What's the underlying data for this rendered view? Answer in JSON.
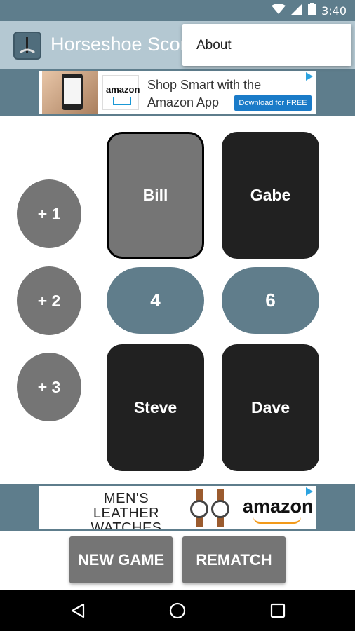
{
  "status_bar": {
    "time": "3:40",
    "icons": [
      "wifi-icon",
      "cell-signal-icon",
      "battery-icon"
    ]
  },
  "app_bar": {
    "title": "Horseshoe Score"
  },
  "overflow_menu": {
    "items": [
      {
        "label": "About"
      }
    ]
  },
  "ad_top": {
    "brand": "amazon",
    "headline": "Shop Smart with the Amazon App",
    "cta": "Download for FREE"
  },
  "ad_bottom": {
    "headline": "MEN'S LEATHER WATCHES",
    "brand": "amazon"
  },
  "increment_buttons": [
    {
      "label": "+ 1"
    },
    {
      "label": "+ 2"
    },
    {
      "label": "+ 3"
    }
  ],
  "teams": [
    {
      "score": "4",
      "players": [
        {
          "name": "Bill",
          "selected": true
        },
        {
          "name": "Steve",
          "selected": false
        }
      ]
    },
    {
      "score": "6",
      "players": [
        {
          "name": "Gabe",
          "selected": false
        },
        {
          "name": "Dave",
          "selected": false
        }
      ]
    }
  ],
  "actions": {
    "new_game": "NEW GAME",
    "rematch": "REMATCH"
  },
  "nav_bar": {
    "icons": [
      "back-icon",
      "home-icon",
      "recents-icon"
    ]
  },
  "colors": {
    "status_bar": "#5e7d8c",
    "app_bar": "#b4c8d2",
    "player_card": "#212121",
    "player_selected": "#757575",
    "score_pill": "#607d8b",
    "buttons": "#757575"
  }
}
